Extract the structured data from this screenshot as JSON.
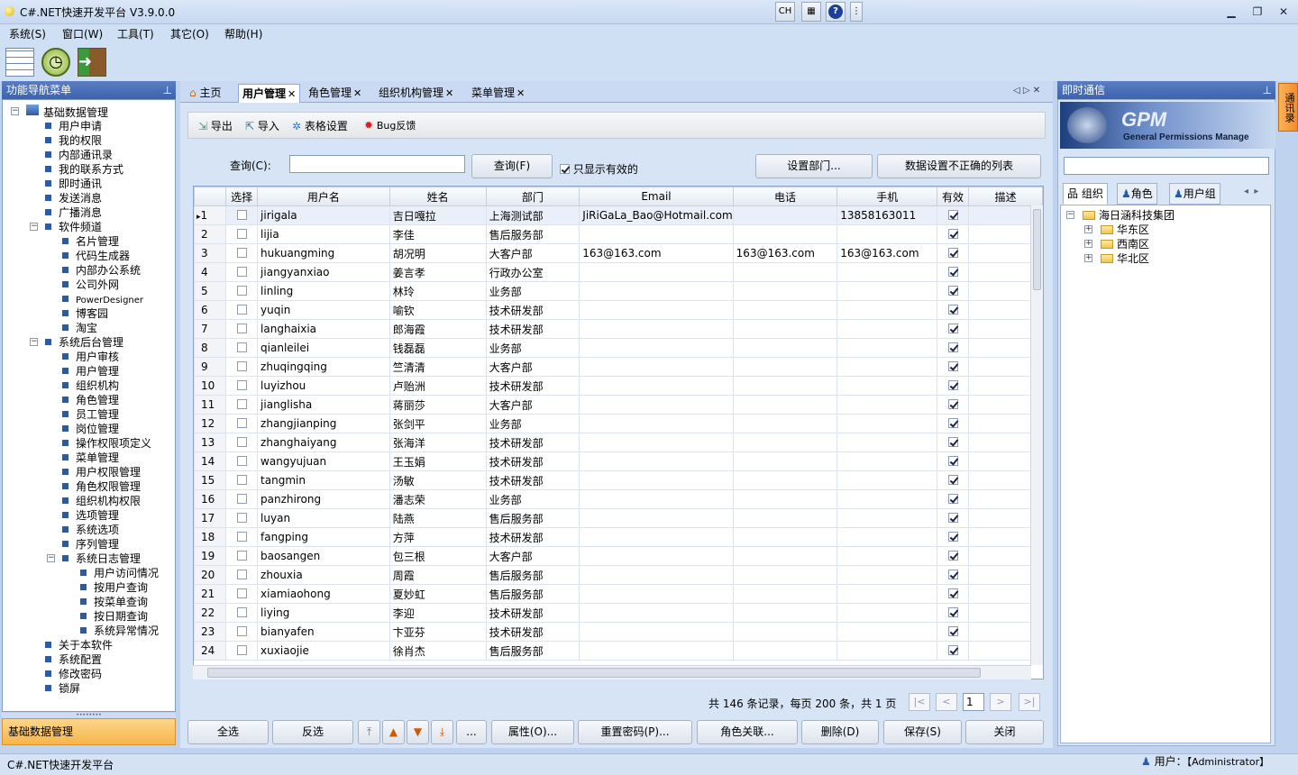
{
  "app": {
    "title": "C#.NET快速开发平台 V3.9.0.0",
    "ime": "CH"
  },
  "menu": [
    "系统(S)",
    "窗口(W)",
    "工具(T)",
    "其它(O)",
    "帮助(H)"
  ],
  "left": {
    "title": "功能导航菜单",
    "footer": "基础数据管理",
    "tree": [
      {
        "l": 0,
        "t": "基础数据管理",
        "tog": "−"
      },
      {
        "l": 1,
        "t": "用户申请"
      },
      {
        "l": 1,
        "t": "我的权限"
      },
      {
        "l": 1,
        "t": "内部通讯录"
      },
      {
        "l": 1,
        "t": "我的联系方式"
      },
      {
        "l": 1,
        "t": "即时通讯"
      },
      {
        "l": 1,
        "t": "发送消息"
      },
      {
        "l": 1,
        "t": "广播消息"
      },
      {
        "l": 1,
        "t": "软件频道",
        "tog": "−"
      },
      {
        "l": 2,
        "t": "名片管理"
      },
      {
        "l": 2,
        "t": "代码生成器"
      },
      {
        "l": 2,
        "t": "内部办公系统"
      },
      {
        "l": 2,
        "t": "公司外网"
      },
      {
        "l": 2,
        "t": "PowerDesigner"
      },
      {
        "l": 2,
        "t": "博客园"
      },
      {
        "l": 2,
        "t": "淘宝"
      },
      {
        "l": 1,
        "t": "系统后台管理",
        "tog": "−"
      },
      {
        "l": 2,
        "t": "用户审核"
      },
      {
        "l": 2,
        "t": "用户管理"
      },
      {
        "l": 2,
        "t": "组织机构"
      },
      {
        "l": 2,
        "t": "角色管理"
      },
      {
        "l": 2,
        "t": "员工管理"
      },
      {
        "l": 2,
        "t": "岗位管理"
      },
      {
        "l": 2,
        "t": "操作权限项定义"
      },
      {
        "l": 2,
        "t": "菜单管理"
      },
      {
        "l": 2,
        "t": "用户权限管理"
      },
      {
        "l": 2,
        "t": "角色权限管理"
      },
      {
        "l": 2,
        "t": "组织机构权限"
      },
      {
        "l": 2,
        "t": "选项管理"
      },
      {
        "l": 2,
        "t": "系统选项"
      },
      {
        "l": 2,
        "t": "序列管理"
      },
      {
        "l": 2,
        "t": "系统日志管理",
        "tog": "−"
      },
      {
        "l": 3,
        "t": "用户访问情况"
      },
      {
        "l": 3,
        "t": "按用户查询"
      },
      {
        "l": 3,
        "t": "按菜单查询"
      },
      {
        "l": 3,
        "t": "按日期查询"
      },
      {
        "l": 3,
        "t": "系统异常情况"
      },
      {
        "l": 1,
        "t": "关于本软件"
      },
      {
        "l": 1,
        "t": "系统配置"
      },
      {
        "l": 1,
        "t": "修改密码"
      },
      {
        "l": 1,
        "t": "锁屏"
      }
    ]
  },
  "tabs": [
    "主页",
    "用户管理",
    "角色管理",
    "组织机构管理",
    "菜单管理"
  ],
  "inner_toolbar": {
    "export": "导出",
    "import": "导入",
    "grid_settings": "表格设置",
    "bug": "Bug反馈"
  },
  "search": {
    "label": "查询(C):",
    "value": "",
    "button": "查询(F)",
    "only_valid": "只显示有效的",
    "set_dept": "设置部门...",
    "bad_list": "数据设置不正确的列表"
  },
  "grid": {
    "columns": [
      "",
      "选择",
      "用户名",
      "姓名",
      "部门",
      "Email",
      "电话",
      "手机",
      "有效",
      "描述"
    ],
    "rows": [
      [
        "1",
        "jirigala",
        "吉日嘎拉",
        "上海测试部",
        "JiRiGaLa_Bao@Hotmail.com",
        "",
        "13858163011"
      ],
      [
        "2",
        "lijia",
        "李佳",
        "售后服务部",
        "",
        "",
        ""
      ],
      [
        "3",
        "hukuangming",
        "胡况明",
        "大客户部",
        "163@163.com",
        "163@163.com",
        "163@163.com"
      ],
      [
        "4",
        "jiangyanxiao",
        "姜言孝",
        "行政办公室",
        "",
        "",
        ""
      ],
      [
        "5",
        "linling",
        "林玲",
        "业务部",
        "",
        "",
        ""
      ],
      [
        "6",
        "yuqin",
        "喻钦",
        "技术研发部",
        "",
        "",
        ""
      ],
      [
        "7",
        "langhaixia",
        "郎海霞",
        "技术研发部",
        "",
        "",
        ""
      ],
      [
        "8",
        "qianleilei",
        "钱磊磊",
        "业务部",
        "",
        "",
        ""
      ],
      [
        "9",
        "zhuqingqing",
        "竺清清",
        "大客户部",
        "",
        "",
        ""
      ],
      [
        "10",
        "luyizhou",
        "卢贻洲",
        "技术研发部",
        "",
        "",
        ""
      ],
      [
        "11",
        "jianglisha",
        "蒋丽莎",
        "大客户部",
        "",
        "",
        ""
      ],
      [
        "12",
        "zhangjianping",
        "张剑平",
        "业务部",
        "",
        "",
        ""
      ],
      [
        "13",
        "zhanghaiyang",
        "张海洋",
        "技术研发部",
        "",
        "",
        ""
      ],
      [
        "14",
        "wangyujuan",
        "王玉娟",
        "技术研发部",
        "",
        "",
        ""
      ],
      [
        "15",
        "tangmin",
        "汤敏",
        "技术研发部",
        "",
        "",
        ""
      ],
      [
        "16",
        "panzhirong",
        "潘志荣",
        "业务部",
        "",
        "",
        ""
      ],
      [
        "17",
        "luyan",
        "陆燕",
        "售后服务部",
        "",
        "",
        ""
      ],
      [
        "18",
        "fangping",
        "方萍",
        "技术研发部",
        "",
        "",
        ""
      ],
      [
        "19",
        "baosangen",
        "包三根",
        "大客户部",
        "",
        "",
        ""
      ],
      [
        "20",
        "zhouxia",
        "周霞",
        "售后服务部",
        "",
        "",
        ""
      ],
      [
        "21",
        "xiamiaohong",
        "夏妙虹",
        "售后服务部",
        "",
        "",
        ""
      ],
      [
        "22",
        "liying",
        "李迎",
        "技术研发部",
        "",
        "",
        ""
      ],
      [
        "23",
        "bianyafen",
        "卞亚芬",
        "技术研发部",
        "",
        "",
        ""
      ],
      [
        "24",
        "xuxiaojie",
        "徐肖杰",
        "售后服务部",
        "",
        "",
        ""
      ]
    ]
  },
  "pager": {
    "summary": "共 146 条记录，每页 200 条，共 1 页",
    "page": "1",
    "first": "|<",
    "prev": "<",
    "next": ">",
    "last": ">|"
  },
  "bottom": {
    "select_all": "全选",
    "invert": "反选",
    "more": "...",
    "props": "属性(O)...",
    "reset_pwd": "重置密码(P)...",
    "role_link": "角色关联...",
    "delete": "删除(D)",
    "save": "保存(S)",
    "close": "关闭"
  },
  "right": {
    "title": "即时通信",
    "gpm": "GPM",
    "gpm_sub": "General Permissions Manage",
    "tabs": [
      "组织",
      "角色",
      "用户组"
    ],
    "tree": [
      {
        "l": 0,
        "t": "海日涵科技集团",
        "tog": "−"
      },
      {
        "l": 1,
        "t": "华东区",
        "tog": "+"
      },
      {
        "l": 1,
        "t": "西南区",
        "tog": "+"
      },
      {
        "l": 1,
        "t": "华北区",
        "tog": "+"
      }
    ],
    "side_tab": "通讯录"
  },
  "status": {
    "left": "C#.NET快速开发平台",
    "user_label": "用户：",
    "user": "【Administrator】"
  },
  "colors": {
    "accent": "#3d63ad",
    "orange": "#f7b54a"
  }
}
